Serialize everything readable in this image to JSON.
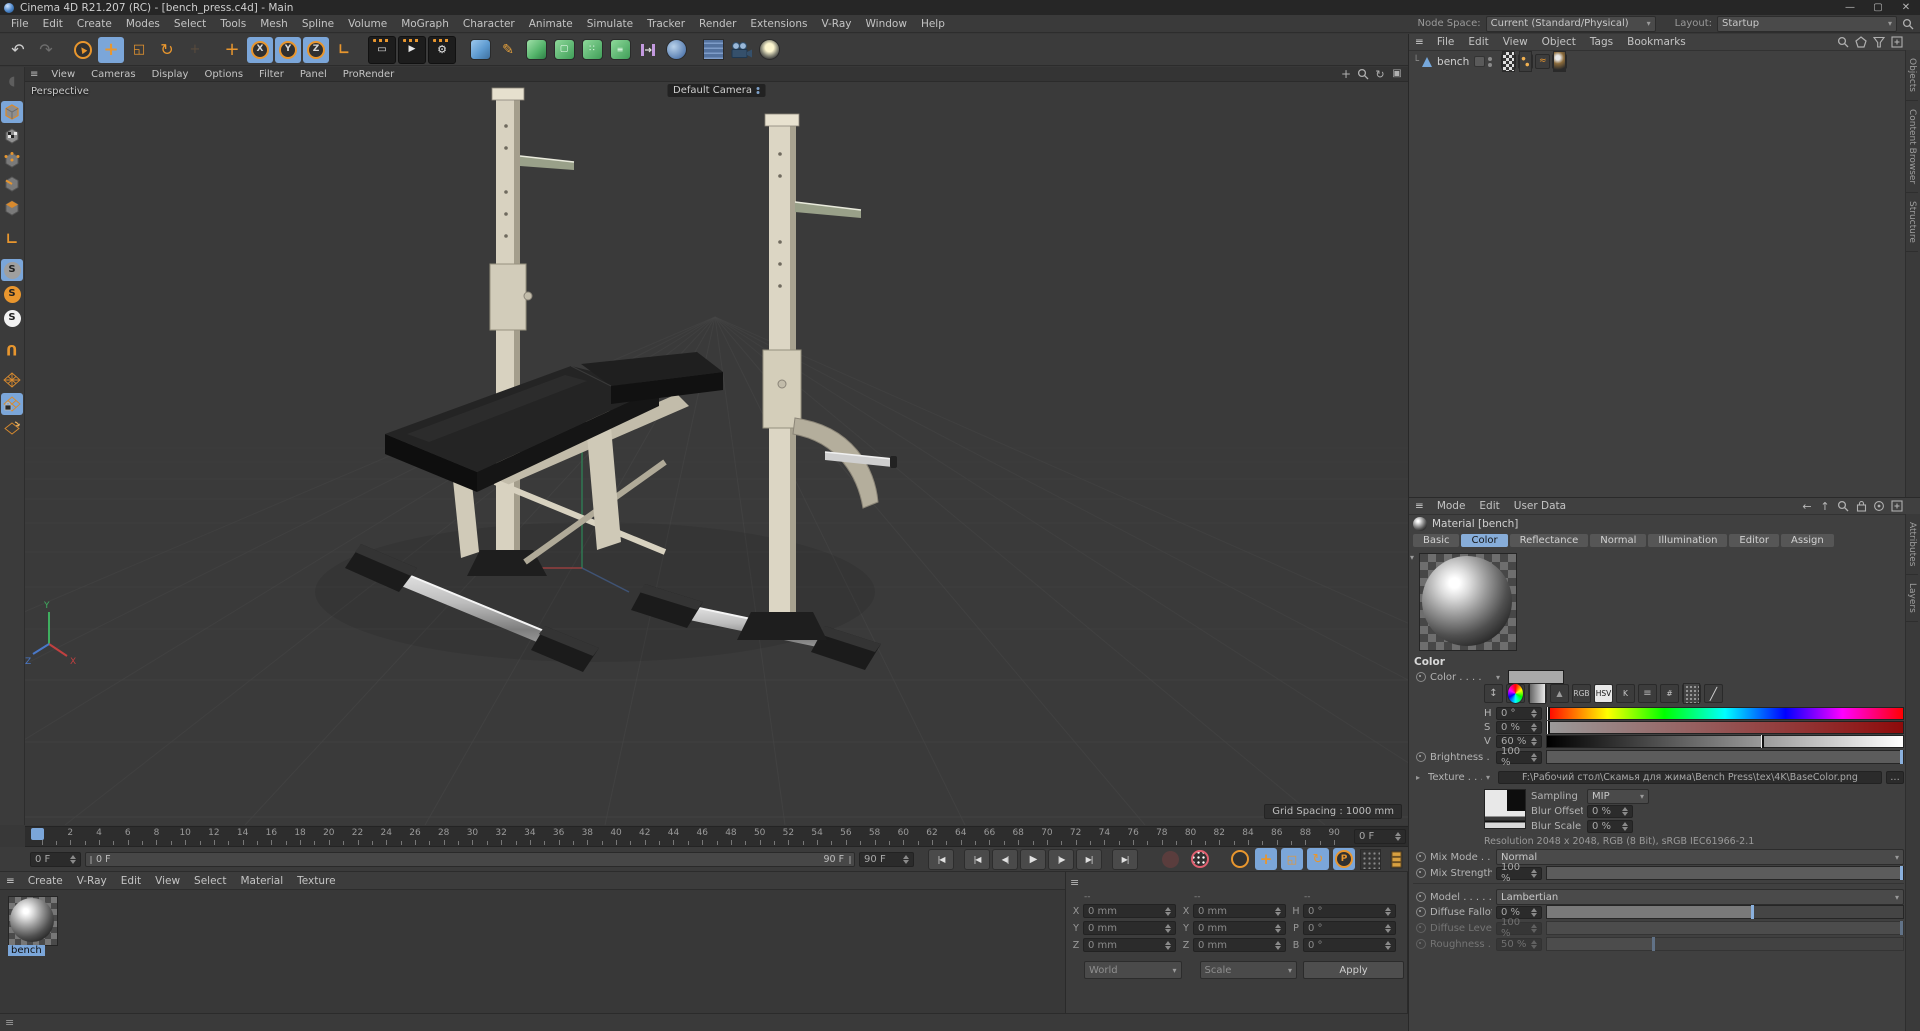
{
  "window": {
    "title": "Cinema 4D R21.207 (RC) - [bench_press.c4d] - Main",
    "controls": [
      {
        "name": "minimize-button",
        "glyph": "—"
      },
      {
        "name": "maximize-button",
        "glyph": "▢"
      },
      {
        "name": "close-button",
        "glyph": "✕"
      }
    ]
  },
  "menubar": {
    "items": [
      "File",
      "Edit",
      "Create",
      "Modes",
      "Select",
      "Tools",
      "Mesh",
      "Spline",
      "Volume",
      "MoGraph",
      "Character",
      "Animate",
      "Simulate",
      "Tracker",
      "Render",
      "Extensions",
      "V-Ray",
      "Window",
      "Help"
    ],
    "node_space_label": "Node Space:",
    "node_space_value": "Current (Standard/Physical)",
    "layout_label": "Layout:",
    "layout_value": "Startup"
  },
  "toolbar": {
    "icons": [
      {
        "name": "undo-icon",
        "glyph": "↶",
        "color": "#cfcfcf",
        "size": 16
      },
      {
        "name": "redo-icon",
        "glyph": "↷",
        "color": "#6e6e6e",
        "size": 16
      },
      {
        "name": "separator"
      },
      {
        "name": "live-selection-icon",
        "ring": "#e8962e",
        "glyph": "▲",
        "color": "#e8962e",
        "rot": -35,
        "size": 8
      },
      {
        "name": "move-tool-icon",
        "glyph": "+",
        "color": "#e8962e",
        "size": 18,
        "bold": true,
        "active": true
      },
      {
        "name": "scale-tool-icon",
        "glyph": "◱",
        "color": "#e8962e",
        "size": 13
      },
      {
        "name": "rotate-tool-icon",
        "glyph": "↻",
        "color": "#e8962e",
        "size": 16
      },
      {
        "name": "recent-tool-icon",
        "glyph": "+",
        "color": "#7d5f41",
        "size": 13,
        "disabled": true
      },
      {
        "name": "separator"
      },
      {
        "name": "axis-lock-icon",
        "glyph": "+",
        "color": "#e8962e",
        "size": 18
      },
      {
        "name": "x-axis-button",
        "ring": "#e8962e",
        "glyph": "X",
        "color": "#d8d8d8",
        "size": 9,
        "bold": true,
        "active": true
      },
      {
        "name": "y-axis-button",
        "ring": "#e8962e",
        "glyph": "Y",
        "color": "#d8d8d8",
        "size": 9,
        "bold": true,
        "active": true
      },
      {
        "name": "z-axis-button",
        "ring": "#e8962e",
        "glyph": "Z",
        "color": "#d8d8d8",
        "size": 9,
        "bold": true,
        "active": true
      },
      {
        "name": "coordinate-system-icon",
        "glyph": "∟",
        "color": "#e8962e",
        "size": 14,
        "bold": true
      },
      {
        "name": "separator"
      },
      {
        "name": "render-view-button",
        "dark": true,
        "topbar": true,
        "glyph": "▭",
        "color": "#e8e8e8",
        "size": 10
      },
      {
        "name": "render-picture-viewer-button",
        "dark": true,
        "topbar": true,
        "glyph": "▶",
        "color": "#e8e8e8",
        "size": 9
      },
      {
        "name": "render-settings-button",
        "dark": true,
        "topbar": true,
        "glyph": "⚙",
        "color": "#e8e8e8",
        "size": 11
      },
      {
        "name": "separator"
      },
      {
        "name": "primitive-cube-button",
        "cssbg": "linear-gradient(135deg,#9cc8ee 0%,#5e9bd0 55%,#3e6f9e 100%)",
        "round": true
      },
      {
        "name": "pen-spline-button",
        "glyph": "✎",
        "color": "#e8a23c",
        "size": 14
      },
      {
        "name": "subdivision-surface-button",
        "cssbg": "linear-gradient(135deg,#9fe0a8 0%,#52b269 60%,#2f7f46 100%)",
        "round": true
      },
      {
        "name": "generator-button",
        "cssbg": "linear-gradient(135deg,#8ed99a,#3f9e58)",
        "round": true,
        "glyph": "▢",
        "color": "#eafcef",
        "size": 9
      },
      {
        "name": "deformer-button",
        "cssbg": "linear-gradient(135deg,#8ed99a,#3f9e58)",
        "round": true,
        "glyph": "∷",
        "color": "#eafcef",
        "size": 9
      },
      {
        "name": "volume-builder-button",
        "cssbg": "linear-gradient(135deg,#8ed99a,#3f9e58)",
        "round": true,
        "glyph": "≡",
        "color": "#eafcef",
        "size": 8
      },
      {
        "name": "symmetry-button",
        "svg": "symmetry"
      },
      {
        "name": "spline-mask-button",
        "cssbg": "radial-gradient(circle at 35% 35%,#b9d2ea,#5d82b4 70%,#3a557e)",
        "roundfull": true
      },
      {
        "name": "separator"
      },
      {
        "name": "floor-button",
        "cssbg": "repeating-linear-gradient(0deg,#7e9cc8 0 1.5px,#54729e 1.5px 5px),repeating-linear-gradient(90deg,rgba(126,156,200,.8) 0 1.5px,rgba(84,114,158,.4) 1.5px 5px)"
      },
      {
        "name": "camera-button",
        "svg": "camera"
      },
      {
        "name": "light-button",
        "cssbg": "radial-gradient(circle at 50% 40%,#fdf6cf 0 28%,#8a8a7a 55%,#3c3c3c 78%)",
        "roundfull": true
      }
    ]
  },
  "left_toolbar": {
    "icons": [
      {
        "name": "make-editable-icon",
        "glyph": "◖",
        "color": "#8a8a8a",
        "size": 13,
        "disabled": true
      },
      {
        "name": "gap"
      },
      {
        "name": "model-mode-button",
        "svg": "cube",
        "active": true
      },
      {
        "name": "texture-mode-button",
        "svg": "cubechecker"
      },
      {
        "name": "point-mode-button",
        "svg": "cubepoints"
      },
      {
        "name": "edge-mode-button",
        "svg": "cubeedge"
      },
      {
        "name": "polygon-mode-button",
        "svg": "cubepoly"
      },
      {
        "name": "gap"
      },
      {
        "name": "enable-axis-icon",
        "glyph": "∟",
        "color": "#e8962e",
        "size": 15,
        "bold": true
      },
      {
        "name": "gap"
      },
      {
        "name": "viewport-solo-off-button",
        "circle": "#9f9f9f",
        "glyph": "S",
        "color": "#222",
        "size": 10,
        "active": true
      },
      {
        "name": "viewport-solo-single-button",
        "circle": "#e8962e",
        "glyph": "S",
        "color": "#222",
        "size": 10
      },
      {
        "name": "viewport-solo-hierarchy-button",
        "circle": "#f2f2f2",
        "glyph": "S",
        "color": "#222",
        "size": 10
      },
      {
        "name": "gap"
      },
      {
        "name": "snap-enable-icon",
        "glyph": "U",
        "color": "#e8962e",
        "size": 14,
        "bold": true,
        "rot": 180
      },
      {
        "name": "gap"
      },
      {
        "name": "workplane-icon",
        "svg": "grid"
      },
      {
        "name": "locked-workplane-button",
        "svg": "gridlock",
        "active": true
      },
      {
        "name": "planar-workplane-icon",
        "svg": "gridrot"
      }
    ]
  },
  "viewport": {
    "menu": [
      "View",
      "Cameras",
      "Display",
      "Options",
      "Filter",
      "Panel",
      "ProRender"
    ],
    "nav_icons": [
      {
        "name": "pan-view-icon",
        "glyph": "+",
        "color": "#b0b0b0",
        "size": 12
      },
      {
        "name": "zoom-view-icon",
        "svg": "magnifier"
      },
      {
        "name": "rotate-view-icon",
        "glyph": "↻",
        "color": "#b0b0b0",
        "size": 11
      },
      {
        "name": "toggle-view-icon",
        "glyph": "▣",
        "color": "#b0b0b0",
        "size": 10
      }
    ],
    "view_label": "Perspective",
    "camera_label": "Default Camera",
    "grid_label": "Grid Spacing : 1000 mm",
    "axis_labels": {
      "x": "X",
      "y": "Y",
      "z": "Z"
    }
  },
  "timeline": {
    "frame_labels": [
      0,
      2,
      4,
      6,
      8,
      10,
      12,
      14,
      16,
      18,
      20,
      22,
      24,
      26,
      28,
      30,
      32,
      34,
      36,
      38,
      40,
      42,
      44,
      46,
      48,
      50,
      52,
      54,
      56,
      58,
      60,
      62,
      64,
      66,
      68,
      70,
      72,
      74,
      76,
      78,
      80,
      82,
      84,
      86,
      88,
      90
    ],
    "max_frame": 90,
    "playhead_frame": 0,
    "end_field": "0 F"
  },
  "playback": {
    "current": "0 F",
    "range_start": "0 F",
    "range_end": "90 F",
    "end_field": "90 F",
    "transport": [
      {
        "name": "goto-start-button",
        "glyph": "|◀"
      },
      {
        "name": "prev-key-button",
        "glyph": "|◀"
      },
      {
        "name": "prev-frame-button",
        "glyph": "◀|"
      },
      {
        "name": "play-button",
        "glyph": "▶",
        "size": 10
      },
      {
        "name": "next-frame-button",
        "glyph": "|▶"
      },
      {
        "name": "next-key-button",
        "glyph": "▶|"
      },
      {
        "name": "goto-end-button",
        "glyph": "▶|"
      }
    ],
    "record_icons": [
      {
        "name": "record-button",
        "circle": "#7a4040",
        "dim": true
      },
      {
        "name": "autokey-button",
        "ring": "#e06070",
        "dots": true
      }
    ],
    "key_toggles": [
      {
        "name": "keyframe-selection-button",
        "ring": "#e8962e"
      },
      {
        "name": "record-position-toggle",
        "glyph": "+",
        "color": "#e8962e",
        "size": 15,
        "bold": true,
        "active": true
      },
      {
        "name": "record-scale-toggle",
        "glyph": "◱",
        "color": "#e8962e",
        "size": 11,
        "active": true
      },
      {
        "name": "record-rotation-toggle",
        "glyph": "↻",
        "color": "#e8962e",
        "size": 13,
        "active": true
      },
      {
        "name": "record-parameter-toggle",
        "ring": "#e8962e",
        "glyph": "P",
        "color": "#e8962e",
        "size": 9,
        "bold": true,
        "active": true
      },
      {
        "name": "point-level-animation-toggle",
        "cssbg": "radial-gradient(#8a8a8a 1px,transparent 1.3px) 1px 1px/5px 5px #343434"
      },
      {
        "name": "minimal-interface-toggle",
        "svg": "filmstrip"
      }
    ]
  },
  "materials_panel": {
    "menu": [
      "Create",
      "V-Ray",
      "Edit",
      "View",
      "Select",
      "Material",
      "Texture"
    ],
    "items": [
      {
        "name": "bench",
        "selected": true
      }
    ]
  },
  "coordinates_panel": {
    "groups": [
      {
        "header": "--",
        "rows": [
          {
            "k": "X",
            "v": "0 mm"
          },
          {
            "k": "Y",
            "v": "0 mm"
          },
          {
            "k": "Z",
            "v": "0 mm"
          }
        ]
      },
      {
        "header": "--",
        "rows": [
          {
            "k": "X",
            "v": "0 mm"
          },
          {
            "k": "Y",
            "v": "0 mm"
          },
          {
            "k": "Z",
            "v": "0 mm"
          }
        ]
      },
      {
        "header": "--",
        "rows": [
          {
            "k": "H",
            "v": "0 °"
          },
          {
            "k": "P",
            "v": "0 °"
          },
          {
            "k": "B",
            "v": "0 °"
          }
        ]
      }
    ],
    "dropdowns": [
      "World",
      "Scale"
    ],
    "apply_label": "Apply"
  },
  "object_manager": {
    "menu": [
      "File",
      "Edit",
      "View",
      "Object",
      "Tags",
      "Bookmarks"
    ],
    "right_icons": [
      {
        "name": "search-icon",
        "svg": "magnifier"
      },
      {
        "name": "scene-browser-icon",
        "svg": "pentagon"
      },
      {
        "name": "filter-icon",
        "svg": "funnel"
      },
      {
        "name": "add-panel-icon",
        "svg": "plusbox"
      }
    ],
    "objects": [
      {
        "name": "bench"
      }
    ],
    "tags": [
      {
        "name": "display-tag-icon",
        "cssbg": "repeating-conic-gradient(#ddd 0% 25%,#333 0% 50%) 0 0/6px 6px"
      },
      {
        "name": "phong-tag-icon",
        "cssbg": "radial-gradient(circle at 32% 35%,#f0b050 1.6px,transparent 2px),radial-gradient(circle at 66% 66%,#f0b050 1.6px,transparent 2px),#3c3c3c"
      },
      {
        "name": "uvw-tag-icon",
        "glyph": "≈",
        "color": "#e8962e",
        "size": 9
      },
      {
        "name": "material-tag-icon",
        "cssbg": "radial-gradient(circle at 35% 30%,#e8e8e8 0 15%,#8a6a3a 40%,#2a2a2a 80%)"
      }
    ],
    "side_tabs": [
      "Objects",
      "Content Browser",
      "Structure"
    ]
  },
  "attributes_panel": {
    "menu": [
      "Mode",
      "Edit",
      "User Data"
    ],
    "right_icons": [
      {
        "name": "back-icon",
        "glyph": "←",
        "color": "#b8b8b8",
        "size": 11
      },
      {
        "name": "up-icon",
        "glyph": "↑",
        "color": "#b8b8b8",
        "size": 11
      },
      {
        "name": "find-icon",
        "svg": "magnifier"
      },
      {
        "name": "lock-icon",
        "svg": "lock"
      },
      {
        "name": "sync-icon",
        "svg": "target"
      },
      {
        "name": "new-panel-icon",
        "svg": "plusbox"
      }
    ],
    "title": "Material [bench]",
    "tabs": [
      "Basic",
      "Color",
      "Reflectance",
      "Normal",
      "Illumination",
      "Editor",
      "Assign"
    ],
    "active_tab": "Color",
    "section_title": "Color",
    "color_toolbar": [
      {
        "name": "swap-icon",
        "glyph": "↕",
        "color": "#b8b8b8",
        "size": 10
      },
      {
        "name": "color-wheel-icon",
        "cssbg": "conic-gradient(red,yellow,lime,cyan,blue,magenta,red)",
        "roundfull": true
      },
      {
        "name": "gradient-icon",
        "cssbg": "linear-gradient(90deg,#666,#e8e8e8)"
      },
      {
        "name": "picture-icon",
        "glyph": "▲",
        "color": "#9a9a9a",
        "size": 8
      },
      {
        "name": "rgb-mode-button",
        "text": "RGB"
      },
      {
        "name": "hsv-mode-button",
        "text": "HSV",
        "on": true
      },
      {
        "name": "k-mode-button",
        "text": "K"
      },
      {
        "name": "mixer-icon",
        "glyph": "≡",
        "color": "#b8b8b8",
        "size": 10
      },
      {
        "name": "hex-icon",
        "text": "#"
      },
      {
        "name": "swatches-icon",
        "cssbg": "radial-gradient(#999 1px,transparent 1.3px) 1px 1px/4px 4px #444"
      },
      {
        "name": "eyedropper-icon",
        "glyph": "╱",
        "color": "#cfcfcf",
        "size": 12
      }
    ],
    "rows": {
      "color": {
        "label": "Color . . . .",
        "swatch": "#a9a9a9"
      },
      "h": {
        "label": "H",
        "value": "0 °"
      },
      "s": {
        "label": "S",
        "value": "0 %"
      },
      "v": {
        "label": "V",
        "value": "60 %",
        "marker_pct": 60
      },
      "brightness": {
        "label": "Brightness . .",
        "value": "100 %"
      },
      "texture": {
        "label": "Texture . . . . .",
        "path": "F:\\Рабочий стол\\Скамья для жима\\Bench Press\\tex\\4K\\BaseColor.png",
        "browse": "..."
      },
      "sampling": {
        "label": "Sampling",
        "value": "MIP"
      },
      "blur_offset": {
        "label": "Blur Offset",
        "value": "0 %"
      },
      "blur_scale": {
        "label": "Blur Scale",
        "value": "0 %"
      },
      "resolution": "Resolution 2048 x 2048, RGB (8 Bit), sRGB IEC61966-2.1",
      "mix_mode": {
        "label": "Mix Mode . .",
        "value": "Normal"
      },
      "mix_strength": {
        "label": "Mix Strength",
        "value": "100 %",
        "fill_pct": 100
      },
      "model": {
        "label": "Model . . . . .",
        "value": "Lambertian"
      },
      "diffuse_falloff": {
        "label": "Diffuse Falloff",
        "value": "0 %",
        "fill_pct": 58
      },
      "diffuse_level": {
        "label": "Diffuse Level",
        "value": "100 %",
        "fill_pct": 100
      },
      "roughness": {
        "label": "Roughness . .",
        "value": "50 %",
        "fill_pct": 30
      }
    },
    "side_tabs": [
      "Attributes",
      "Layers"
    ]
  },
  "colors": {
    "accent_blue": "#7ba6d9",
    "accent_orange": "#e8962e",
    "panel_bg": "#404040",
    "viewport_bg": "#3a3a3a",
    "field_bg": "#2b2b2b"
  }
}
